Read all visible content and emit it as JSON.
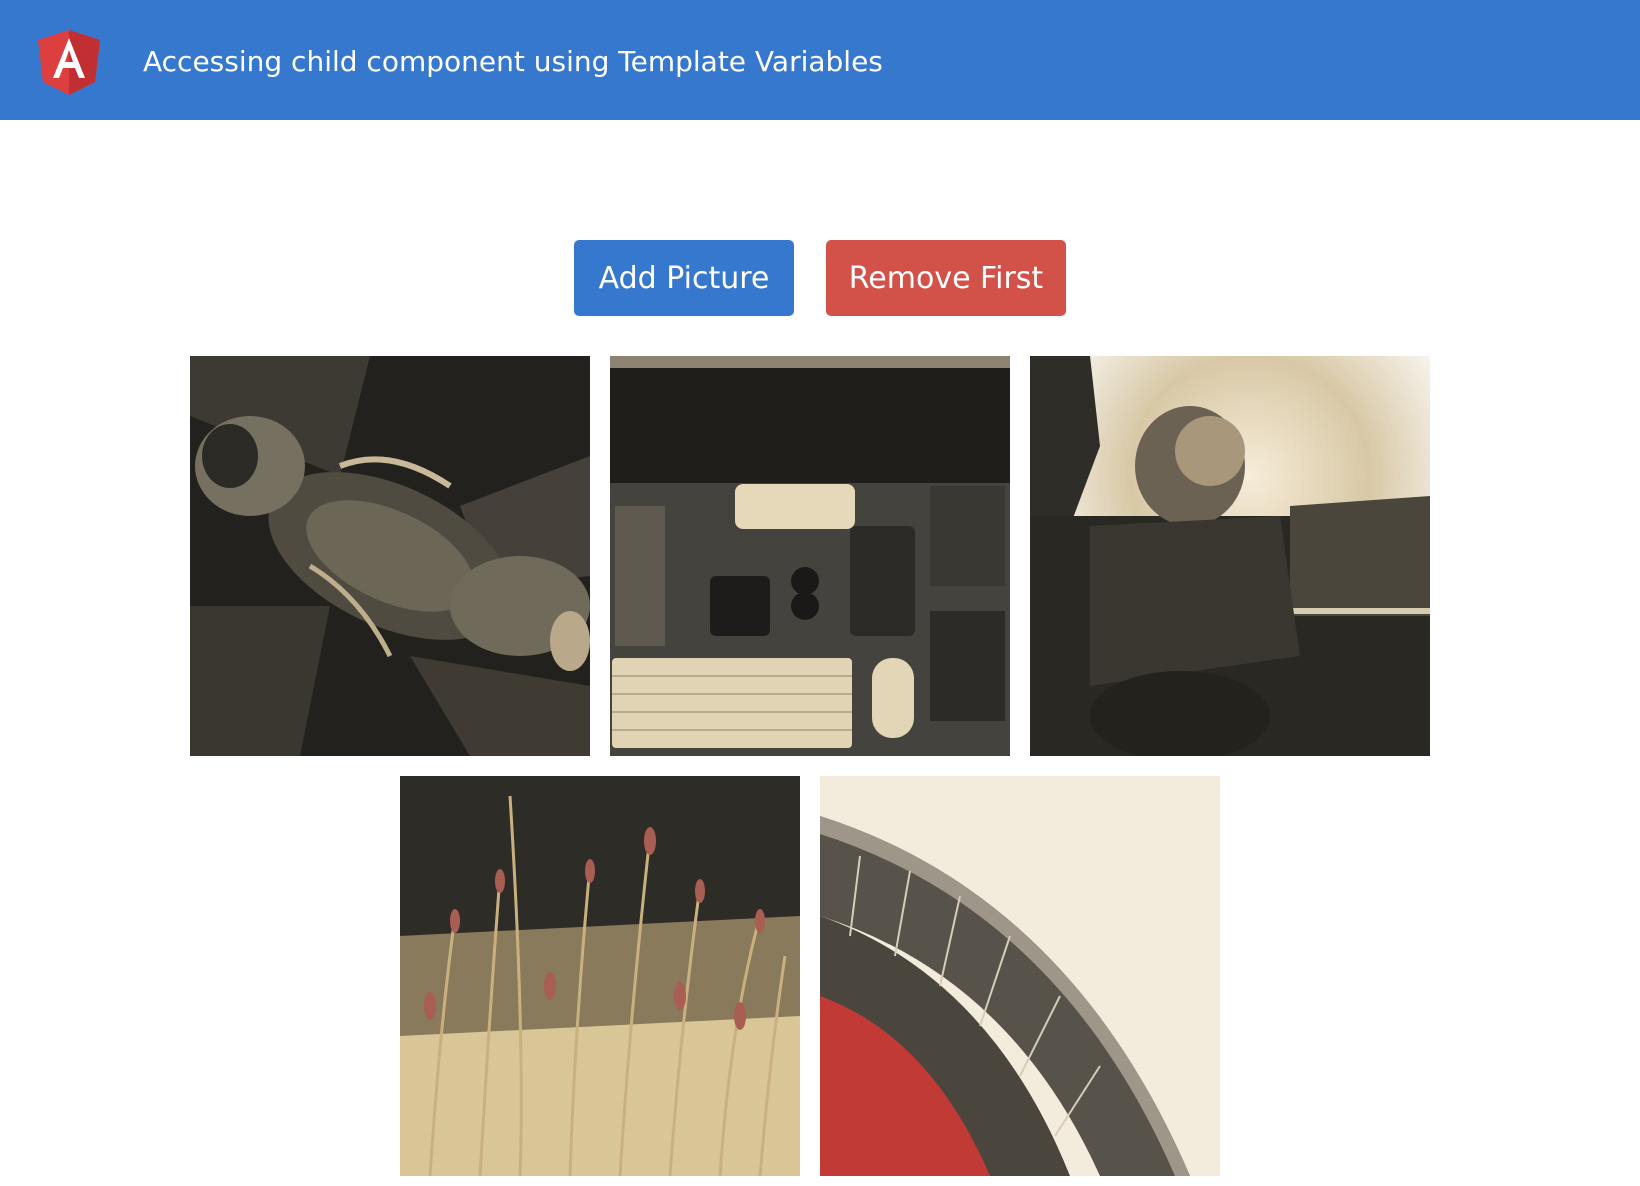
{
  "header": {
    "title": "Accessing child component using Template Variables",
    "logo": "angular-logo-icon",
    "background": "#3678cd"
  },
  "actions": {
    "add_label": "Add Picture",
    "remove_label": "Remove First",
    "add_color": "#3678cd",
    "remove_color": "#d2524a"
  },
  "gallery": {
    "pictures": [
      {
        "subject": "arch-ceiling"
      },
      {
        "subject": "desk-workspace"
      },
      {
        "subject": "person-sunset"
      },
      {
        "subject": "grass-field"
      },
      {
        "subject": "curved-building"
      }
    ]
  }
}
